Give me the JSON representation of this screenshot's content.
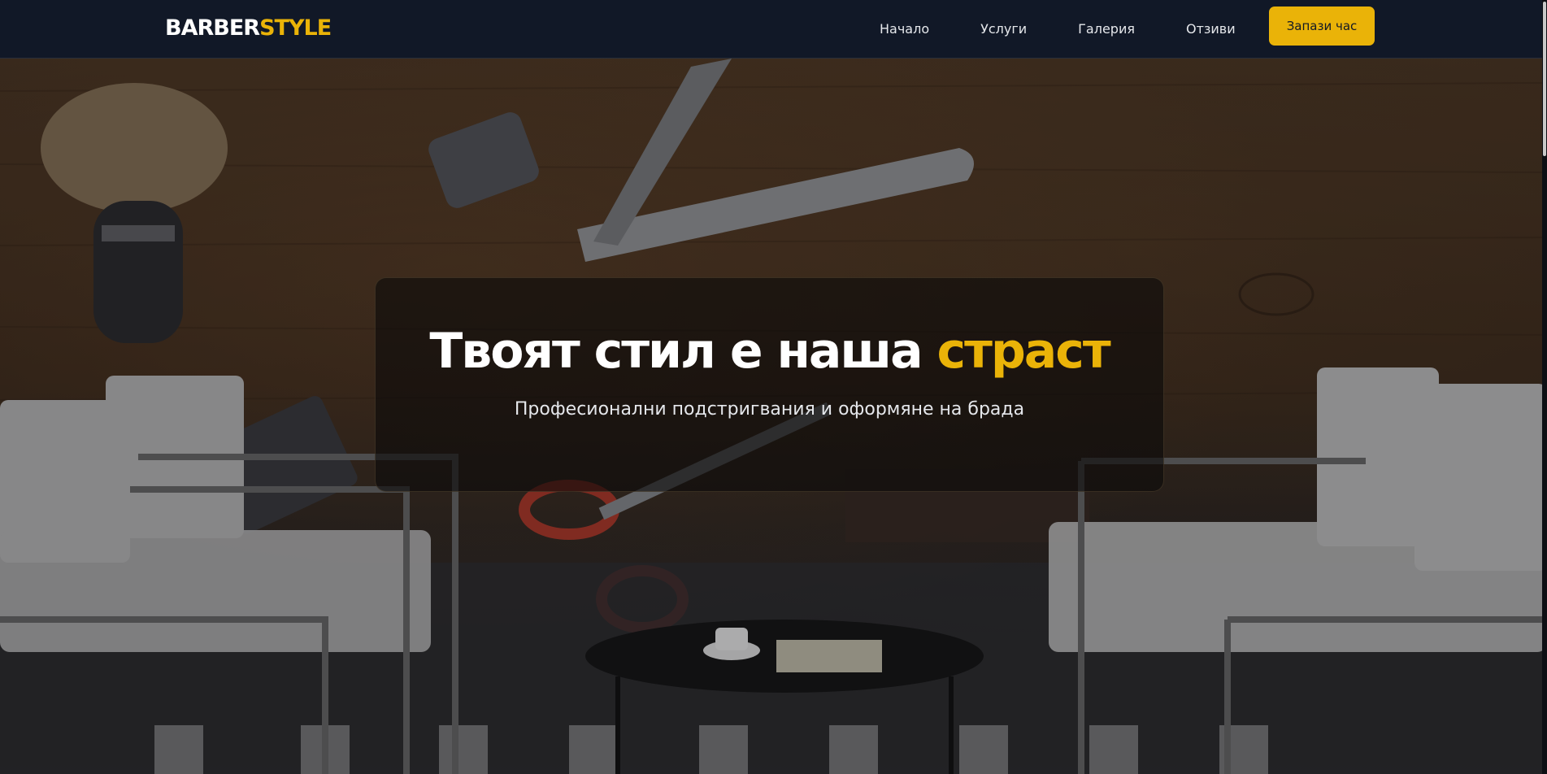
{
  "nav": {
    "logo_part1": "BARBER",
    "logo_part2": "STYLE",
    "links": [
      "Начало",
      "Услуги",
      "Галерия",
      "Отзиви"
    ],
    "cta_label": "Запази час"
  },
  "hero": {
    "title_main": "Твоят стил е наша ",
    "title_accent": "страст",
    "subtitle": "Професионални подстригвания и оформяне на брада"
  },
  "colors": {
    "accent": "#eab308",
    "nav_bg": "#111827",
    "text_light": "#ffffff"
  }
}
